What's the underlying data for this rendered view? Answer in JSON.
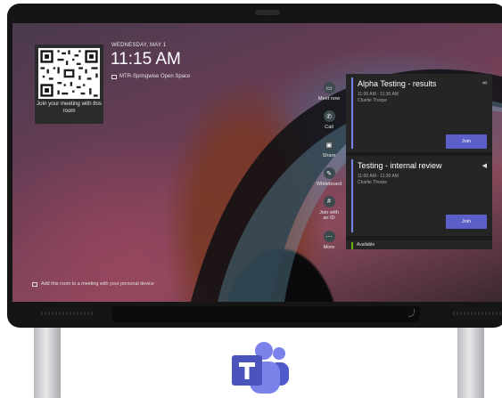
{
  "clock": {
    "date": "WEDNESDAY, MAY 1",
    "time": "11:15 AM",
    "room_name": "MTR-Springwise Open Space"
  },
  "qr": {
    "caption": "Join your meeting with this room"
  },
  "actions": [
    {
      "label": "Meet now",
      "icon": "video-icon",
      "glyph": "▭"
    },
    {
      "label": "Call",
      "icon": "phone-icon",
      "glyph": "✆"
    },
    {
      "label": "Share",
      "icon": "share-screen-icon",
      "glyph": "▣"
    },
    {
      "label": "Whiteboard",
      "icon": "whiteboard-icon",
      "glyph": "✎"
    },
    {
      "label": "Join with an ID",
      "icon": "hash-icon",
      "glyph": "#"
    },
    {
      "label": "More",
      "icon": "more-icon",
      "glyph": "⋯"
    }
  ],
  "meetings": [
    {
      "title": "Alpha Testing - results",
      "time": "11:00 AM - 11:30 AM",
      "organizer": "Charlie Thorpe",
      "join_label": "Join",
      "icon": "glasses-icon"
    },
    {
      "title": "Testing - internal review",
      "time": "11:00 AM - 11:30 AM",
      "organizer": "Charlie Thorpe",
      "join_label": "Join",
      "icon": "speaker-icon"
    }
  ],
  "availability": {
    "label": "Available"
  },
  "footer": {
    "tip": "Add this room to a meeting with your personal device"
  },
  "colors": {
    "accent": "#5b5fc7",
    "meeting_bar": "#7b83eb",
    "available": "#6bb700"
  }
}
